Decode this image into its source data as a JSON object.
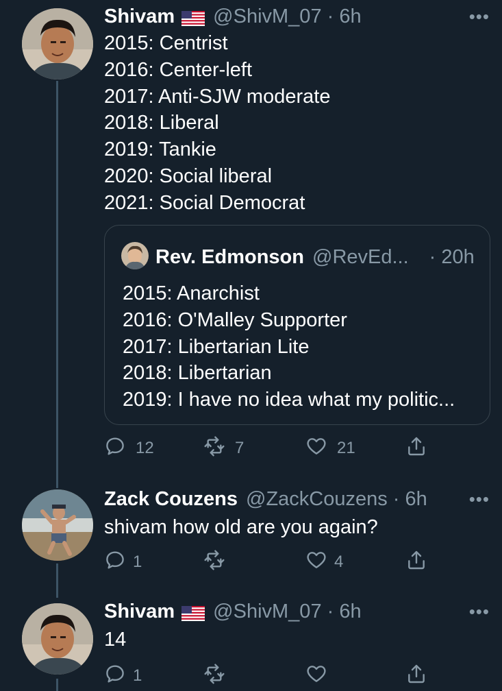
{
  "tweets": [
    {
      "name": "Shivam",
      "flag": "us-flag-icon",
      "handle_time": "@ShivM_07 · 6h",
      "more": "•••",
      "lines": "2015: Centrist\n2016: Center-left\n2017: Anti-SJW moderate\n2018: Liberal\n2019: Tankie\n2020: Social liberal\n2021: Social Democrat",
      "quote": {
        "name": "Rev. Edmonson",
        "handle": "@RevEd...",
        "time": "· 20h",
        "lines": "2015: Anarchist\n2016: O'Malley Supporter\n2017: Libertarian Lite\n2018: Libertarian\n2019: I have no idea what my politic..."
      },
      "actions": {
        "reply": "12",
        "retweet": "7",
        "like": "21"
      }
    },
    {
      "name": "Zack Couzens",
      "handle_time": "@ZackCouzens · 6h",
      "more": "•••",
      "lines": "shivam how old are you again?",
      "actions": {
        "reply": "1",
        "retweet": "",
        "like": "4"
      }
    },
    {
      "name": "Shivam",
      "flag": "us-flag-icon",
      "handle_time": "@ShivM_07 · 6h",
      "more": "•••",
      "lines": "14",
      "actions": {
        "reply": "1",
        "retweet": "",
        "like": ""
      }
    }
  ],
  "colors": {
    "background": "#15202b",
    "secondary_text": "#8899a6",
    "border": "#38444d",
    "thread_line": "#3d5466"
  }
}
